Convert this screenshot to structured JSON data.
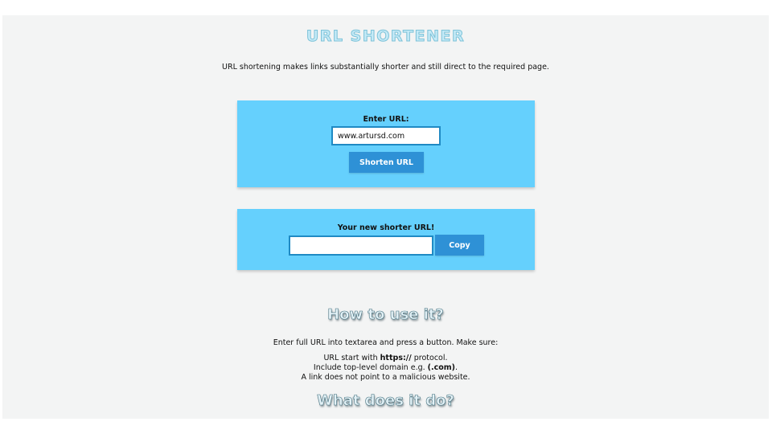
{
  "header": {
    "title": "URL SHORTENER",
    "subtitle": "URL shortening makes links substantially shorter and still direct to the required page."
  },
  "shorten_panel": {
    "label": "Enter URL:",
    "input_value": "www.artursd.com",
    "button_label": "Shorten URL"
  },
  "result_panel": {
    "label": "Your new shorter URL!",
    "output_value": "",
    "copy_label": "Copy"
  },
  "how_to": {
    "heading": "How to use it?",
    "intro": "Enter full URL into textarea and press a button. Make sure:",
    "rule1_pre": "URL start with ",
    "rule1_bold": "https://",
    "rule1_post": " protocol.",
    "rule2_pre": "Include top-level domain e.g. ",
    "rule2_bold": "(.com)",
    "rule2_post": ".",
    "rule3": "A link does not point to a malicious website."
  },
  "what_it_does": {
    "heading": "What does it do?"
  },
  "colors": {
    "panel": "#65d0fd",
    "button": "#2e91d6",
    "input_border": "#1f8ac4",
    "background": "#f3f4f4"
  }
}
